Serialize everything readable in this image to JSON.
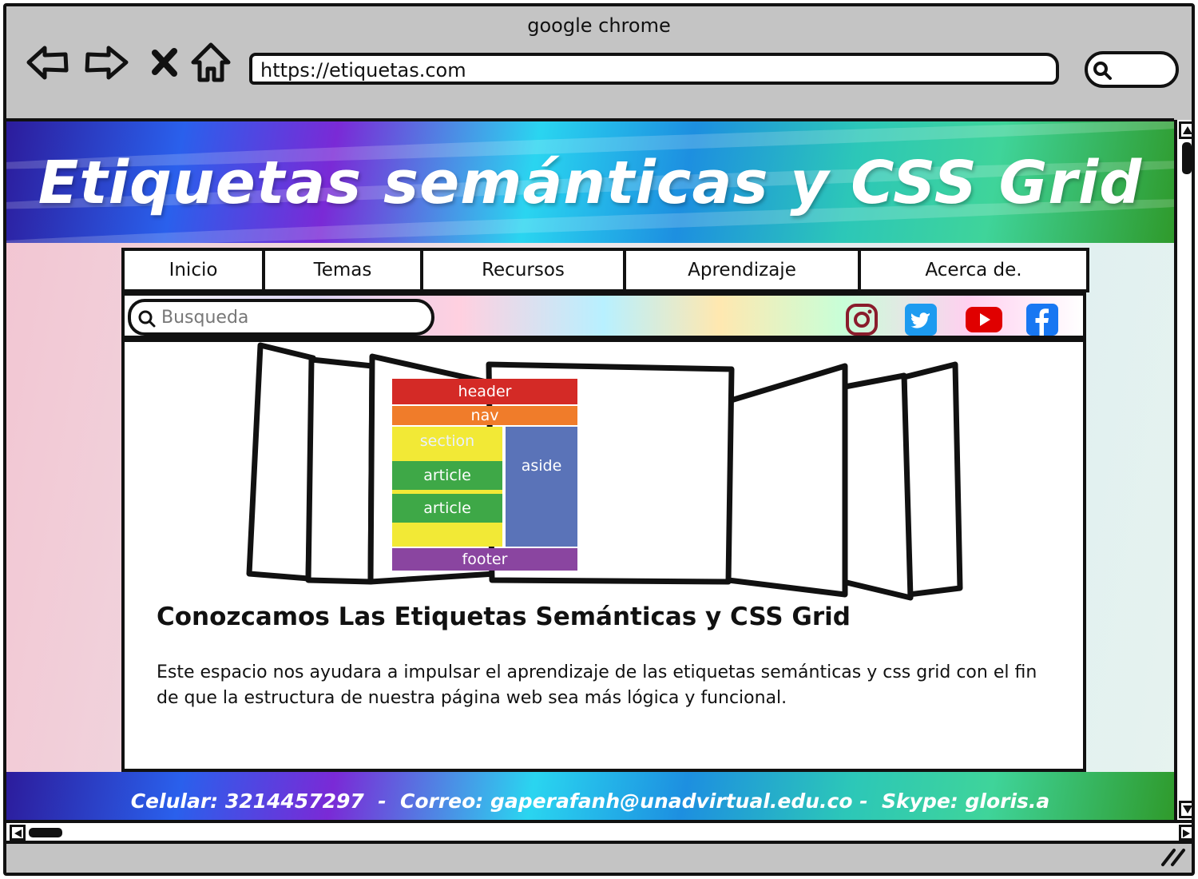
{
  "browser": {
    "window_title": "google chrome",
    "url": "https://etiquetas.com",
    "nav_icons": [
      "back-arrow-icon",
      "forward-arrow-icon",
      "close-icon",
      "home-icon"
    ]
  },
  "site": {
    "title": "Etiquetas semánticas y CSS Grid",
    "nav": [
      {
        "label": "Inicio"
      },
      {
        "label": "Temas"
      },
      {
        "label": "Recursos"
      },
      {
        "label": "Aprendizaje"
      },
      {
        "label": "Acerca de."
      }
    ],
    "search": {
      "placeholder": "Busqueda"
    },
    "social": [
      "instagram-icon",
      "twitter-icon",
      "youtube-icon",
      "facebook-icon"
    ],
    "grid_diagram": {
      "header": "header",
      "nav": "nav",
      "section": "section",
      "article_1": "article",
      "article_2": "article",
      "aside": "aside",
      "footer": "footer"
    },
    "heading": "Conozcamos Las Etiquetas Semánticas y CSS Grid",
    "body": "Este espacio nos ayudara a impulsar el aprendizaje de las etiquetas semánticas y css grid con el fin de que la estructura de nuestra página web sea más lógica y funcional.",
    "footer": "Celular: 3214457297  -  Correo: gaperafanh@unadvirtual.edu.co -  Skype: gloris.a"
  },
  "colors": {
    "instagram": "#8a1c2c",
    "twitter": "#1d9bf0",
    "youtube": "#e00000",
    "facebook": "#1877f2"
  }
}
